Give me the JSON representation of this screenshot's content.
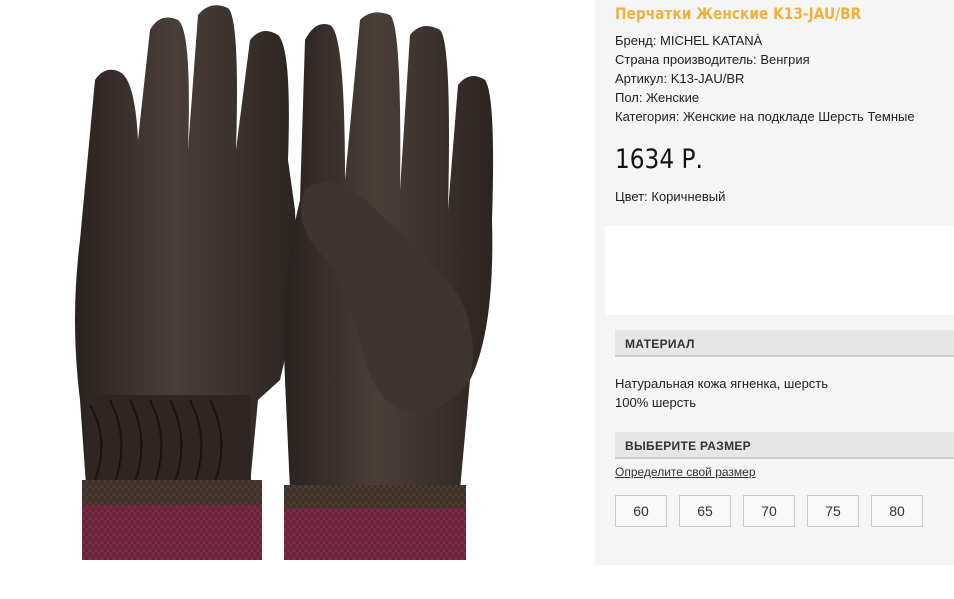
{
  "product": {
    "title": "Перчатки Женские K13-JAU/BR",
    "image_alt": "gloves-photo"
  },
  "specs": [
    {
      "label": "Бренд:",
      "value": "MICHEL KATANÀ"
    },
    {
      "label": "Страна производитель:",
      "value": "Венгрия"
    },
    {
      "label": "Артикул:",
      "value": "K13-JAU/BR"
    },
    {
      "label": "Пол:",
      "value": "Женские"
    },
    {
      "label": "Категория:",
      "value": "Женские на подкладе Шерсть Темные"
    }
  ],
  "price": "1634 Р.",
  "color": {
    "label": "Цвет:",
    "value": "Коричневый"
  },
  "material": {
    "heading": "МАТЕРИАЛ",
    "lines": [
      "Натуральная кожа ягненка, шерсть",
      "100% шерсть"
    ]
  },
  "size": {
    "heading": "ВЫБЕРИТЕ РАЗМЕР",
    "link": "Определите свой размер",
    "options": [
      "60",
      "65",
      "70",
      "75",
      "80"
    ]
  },
  "colors": {
    "title": "#f0b23c",
    "leather": "#3a302c",
    "cuff_brown": "#4a3a30",
    "cuff_burgundy": "#7a2a44"
  }
}
